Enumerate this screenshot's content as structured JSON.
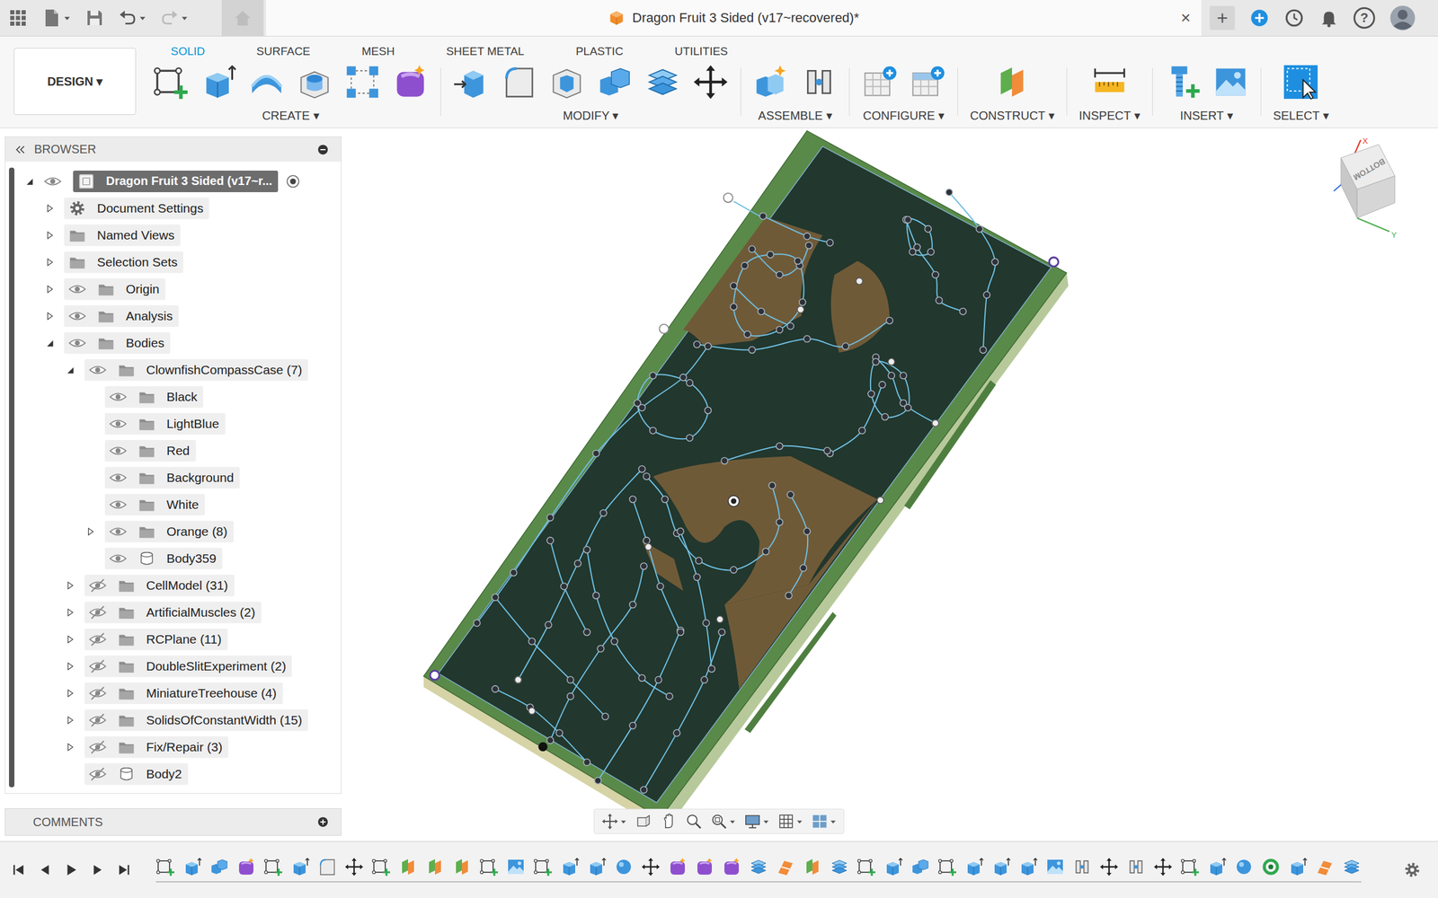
{
  "window": {
    "title": "Dragon Fruit 3 Sided (v17~recovered)*",
    "close": "×",
    "new_tab": "+",
    "help": "?"
  },
  "history": {
    "undo_enabled": true,
    "redo_enabled": false
  },
  "workspace": "DESIGN ▾",
  "tabs": [
    {
      "label": "SOLID",
      "selected": true
    },
    {
      "label": "SURFACE",
      "selected": false
    },
    {
      "label": "MESH",
      "selected": false
    },
    {
      "label": "SHEET METAL",
      "selected": false
    },
    {
      "label": "PLASTIC",
      "selected": false
    },
    {
      "label": "UTILITIES",
      "selected": false
    }
  ],
  "tool_groups": [
    {
      "label": "CREATE ▾",
      "tools": [
        {
          "kind": "sketch"
        },
        {
          "kind": "extrude"
        },
        {
          "kind": "revolve"
        },
        {
          "kind": "hole"
        },
        {
          "kind": "pattern"
        },
        {
          "kind": "form"
        }
      ]
    },
    {
      "label": "MODIFY ▾",
      "tools": [
        {
          "kind": "press-pull"
        },
        {
          "kind": "fillet"
        },
        {
          "kind": "shell"
        },
        {
          "kind": "combine"
        },
        {
          "kind": "offset"
        },
        {
          "kind": "move"
        }
      ]
    },
    {
      "label": "ASSEMBLE ▾",
      "tools": [
        {
          "kind": "new-component"
        },
        {
          "kind": "joint"
        }
      ]
    },
    {
      "label": "CONFIGURE ▾",
      "tools": [
        {
          "kind": "config-add"
        },
        {
          "kind": "config-table"
        }
      ]
    },
    {
      "label": "CONSTRUCT ▾",
      "tools": [
        {
          "kind": "plane"
        }
      ]
    },
    {
      "label": "INSPECT ▾",
      "tools": [
        {
          "kind": "measure"
        }
      ]
    },
    {
      "label": "INSERT ▾",
      "tools": [
        {
          "kind": "bolt"
        },
        {
          "kind": "canvas"
        }
      ]
    },
    {
      "label": "SELECT ▾",
      "tools": [
        {
          "kind": "select"
        }
      ]
    }
  ],
  "browser": {
    "title": "BROWSER",
    "items": [
      {
        "label": "Dragon Fruit 3 Sided (v17~r...",
        "level": 0,
        "kind": "document",
        "expandable": true,
        "expanded": true,
        "has_eye": true,
        "visible": true,
        "active": true
      },
      {
        "label": "Document Settings",
        "level": 1,
        "kind": "settings",
        "expandable": true,
        "expanded": false,
        "has_eye": false,
        "visible": true,
        "active": false
      },
      {
        "label": "Named Views",
        "level": 1,
        "kind": "folder",
        "expandable": true,
        "expanded": false,
        "has_eye": false,
        "visible": true,
        "active": false
      },
      {
        "label": "Selection Sets",
        "level": 1,
        "kind": "folder",
        "expandable": true,
        "expanded": false,
        "has_eye": false,
        "visible": true,
        "active": false
      },
      {
        "label": "Origin",
        "level": 1,
        "kind": "folder",
        "expandable": true,
        "expanded": false,
        "has_eye": true,
        "visible": true,
        "active": false
      },
      {
        "label": "Analysis",
        "level": 1,
        "kind": "folder",
        "expandable": true,
        "expanded": false,
        "has_eye": true,
        "visible": true,
        "active": false
      },
      {
        "label": "Bodies",
        "level": 1,
        "kind": "folder",
        "expandable": true,
        "expanded": true,
        "has_eye": true,
        "visible": true,
        "active": false
      },
      {
        "label": "ClownfishCompassCase (7)",
        "level": 2,
        "kind": "folder",
        "expandable": true,
        "expanded": true,
        "has_eye": true,
        "visible": true,
        "active": false
      },
      {
        "label": "Black",
        "level": 3,
        "kind": "folder",
        "expandable": false,
        "expanded": false,
        "has_eye": true,
        "visible": true,
        "active": false
      },
      {
        "label": "LightBlue",
        "level": 3,
        "kind": "folder",
        "expandable": false,
        "expanded": false,
        "has_eye": true,
        "visible": true,
        "active": false
      },
      {
        "label": "Red",
        "level": 3,
        "kind": "folder",
        "expandable": false,
        "expanded": false,
        "has_eye": true,
        "visible": true,
        "active": false
      },
      {
        "label": "Background",
        "level": 3,
        "kind": "folder",
        "expandable": false,
        "expanded": false,
        "has_eye": true,
        "visible": true,
        "active": false
      },
      {
        "label": "White",
        "level": 3,
        "kind": "folder",
        "expandable": false,
        "expanded": false,
        "has_eye": true,
        "visible": true,
        "active": false
      },
      {
        "label": "Orange (8)",
        "level": 3,
        "kind": "folder",
        "expandable": true,
        "expanded": false,
        "has_eye": true,
        "visible": true,
        "active": false
      },
      {
        "label": "Body359",
        "level": 3,
        "kind": "body",
        "expandable": false,
        "expanded": false,
        "has_eye": true,
        "visible": true,
        "active": false
      },
      {
        "label": "CellModel (31)",
        "level": 2,
        "kind": "folder",
        "expandable": true,
        "expanded": false,
        "has_eye": true,
        "visible": false,
        "active": false
      },
      {
        "label": "ArtificialMuscles (2)",
        "level": 2,
        "kind": "folder",
        "expandable": true,
        "expanded": false,
        "has_eye": true,
        "visible": false,
        "active": false
      },
      {
        "label": "RCPlane (11)",
        "level": 2,
        "kind": "folder",
        "expandable": true,
        "expanded": false,
        "has_eye": true,
        "visible": false,
        "active": false
      },
      {
        "label": "DoubleSlitExperiment (2)",
        "level": 2,
        "kind": "folder",
        "expandable": true,
        "expanded": false,
        "has_eye": true,
        "visible": false,
        "active": false
      },
      {
        "label": "MiniatureTreehouse (4)",
        "level": 2,
        "kind": "folder",
        "expandable": true,
        "expanded": false,
        "has_eye": true,
        "visible": false,
        "active": false
      },
      {
        "label": "SolidsOfConstantWidth (15)",
        "level": 2,
        "kind": "folder",
        "expandable": true,
        "expanded": false,
        "has_eye": true,
        "visible": false,
        "active": false
      },
      {
        "label": "Fix/Repair (3)",
        "level": 2,
        "kind": "folder",
        "expandable": true,
        "expanded": false,
        "has_eye": true,
        "visible": false,
        "active": false
      },
      {
        "label": "Body2",
        "level": 2,
        "kind": "body",
        "expandable": false,
        "expanded": false,
        "has_eye": true,
        "visible": false,
        "active": false
      }
    ]
  },
  "comments": {
    "title": "COMMENTS"
  },
  "viewcube": {
    "face": "BOTTOM",
    "axes": [
      {
        "label": "X",
        "color": "#e23b2e"
      },
      {
        "label": "Y",
        "color": "#4caf50"
      }
    ]
  },
  "navigation": [
    {
      "kind": "orbit",
      "dropdown": true
    },
    {
      "kind": "look-at",
      "dropdown": false
    },
    {
      "kind": "pan",
      "dropdown": false
    },
    {
      "kind": "zoom",
      "dropdown": false
    },
    {
      "kind": "fit",
      "dropdown": true
    },
    {
      "kind": "display",
      "dropdown": true
    },
    {
      "kind": "grid",
      "dropdown": true
    },
    {
      "kind": "viewports",
      "dropdown": true
    }
  ],
  "timeline": {
    "controls": [
      {
        "kind": "first"
      },
      {
        "kind": "previous"
      },
      {
        "kind": "play"
      },
      {
        "kind": "next"
      },
      {
        "kind": "last"
      }
    ],
    "features": [
      {
        "kind": "sketch"
      },
      {
        "kind": "extrude"
      },
      {
        "kind": "combine"
      },
      {
        "kind": "form"
      },
      {
        "kind": "sketch"
      },
      {
        "kind": "extrude"
      },
      {
        "kind": "fillet"
      },
      {
        "kind": "move"
      },
      {
        "kind": "sketch"
      },
      {
        "kind": "plane"
      },
      {
        "kind": "plane"
      },
      {
        "kind": "plane"
      },
      {
        "kind": "sketch"
      },
      {
        "kind": "canvas"
      },
      {
        "kind": "sketch"
      },
      {
        "kind": "extrude"
      },
      {
        "kind": "extrude"
      },
      {
        "kind": "sphere"
      },
      {
        "kind": "move"
      },
      {
        "kind": "form"
      },
      {
        "kind": "form"
      },
      {
        "kind": "form"
      },
      {
        "kind": "offset"
      },
      {
        "kind": "split"
      },
      {
        "kind": "plane"
      },
      {
        "kind": "offset"
      },
      {
        "kind": "sketch"
      },
      {
        "kind": "extrude"
      },
      {
        "kind": "combine"
      },
      {
        "kind": "sketch"
      },
      {
        "kind": "extrude"
      },
      {
        "kind": "extrude"
      },
      {
        "kind": "extrude"
      },
      {
        "kind": "canvas"
      },
      {
        "kind": "joint"
      },
      {
        "kind": "move"
      },
      {
        "kind": "joint"
      },
      {
        "kind": "move"
      },
      {
        "kind": "sketch"
      },
      {
        "kind": "extrude"
      },
      {
        "kind": "sphere"
      },
      {
        "kind": "ring"
      },
      {
        "kind": "extrude"
      },
      {
        "kind": "split"
      },
      {
        "kind": "offset"
      }
    ]
  }
}
